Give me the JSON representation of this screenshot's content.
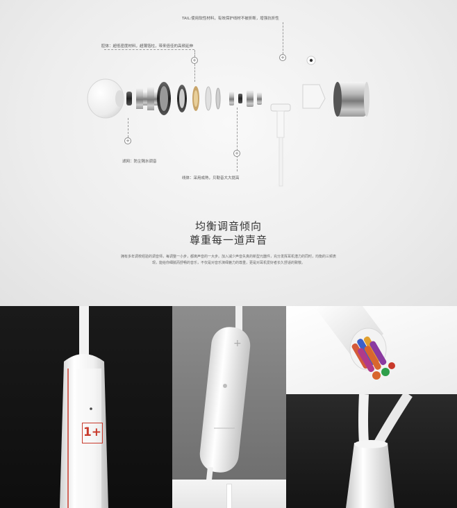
{
  "hero": {
    "callouts": {
      "tail": "TAIL:使用软性材料，有效保护线材不被折断，增强抗折性",
      "cavity": "腔体：超低密度材料，超薄箔柱，带来倍佳的高频延伸",
      "filter": "滤网：防尘隔水调音",
      "cable": "线体：采用成熟，贝勒音大大提高"
    },
    "heading_line1": "均衡调音倾向",
    "heading_line2": "尊重每一道声音",
    "description": "拥有多年调校经验的调音师，每调整一小步，都离声音的一大步。加入减少声音失真的新型元器件，充分发挥耳机潜力的同时，均衡的三频表现，能给你细腻而舒畅的音乐，不仅是对音乐演绎魅力的尊重，更是对耳机爱好者长久舒适的致敬。"
  },
  "panels": {
    "logo_text": "1+"
  },
  "colors": {
    "accent_red": "#c8392b",
    "wire_colors": [
      "#d45a3a",
      "#3a5fc8",
      "#e0a030",
      "#2f9e4a",
      "#b03a8a",
      "#d8662e",
      "#8a3aa0",
      "#3aa0a0"
    ]
  }
}
